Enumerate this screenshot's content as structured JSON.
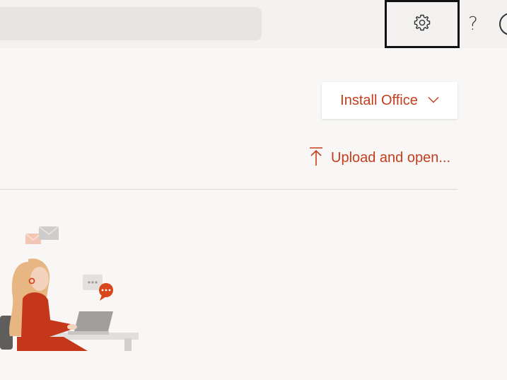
{
  "topbar": {
    "search_icon": "search-field",
    "settings_icon": "gear-icon",
    "help_label": "?",
    "account_icon": "account-icon"
  },
  "main": {
    "install_button": {
      "label": "Install Office",
      "icon": "chevron-down-icon"
    },
    "upload_link": {
      "label": "Upload and open...",
      "icon": "upload-icon"
    }
  },
  "colors": {
    "accent": "#c43e1c",
    "topbar_bg": "#f3f2f1",
    "page_bg": "#f8f7f6"
  }
}
